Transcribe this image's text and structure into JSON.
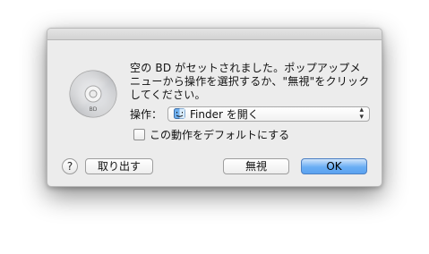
{
  "dialog": {
    "message": "空の BD がセットされました。ポップアップメ\nニューから操作を選択するか、\"無視\"をクリック\nしてください。",
    "disc_icon": "bd-disc-icon",
    "disc_text": "BD"
  },
  "action": {
    "label": "操作：",
    "selected": "Finder を開く",
    "icon": "finder-icon"
  },
  "checkbox": {
    "label": "この動作をデフォルトにする",
    "checked": false
  },
  "buttons": {
    "help": "?",
    "eject": "取り出す",
    "ignore": "無視",
    "ok": "OK"
  },
  "colors": {
    "ok_button": "#5aa2f0",
    "dialog_background": "#ececec"
  }
}
